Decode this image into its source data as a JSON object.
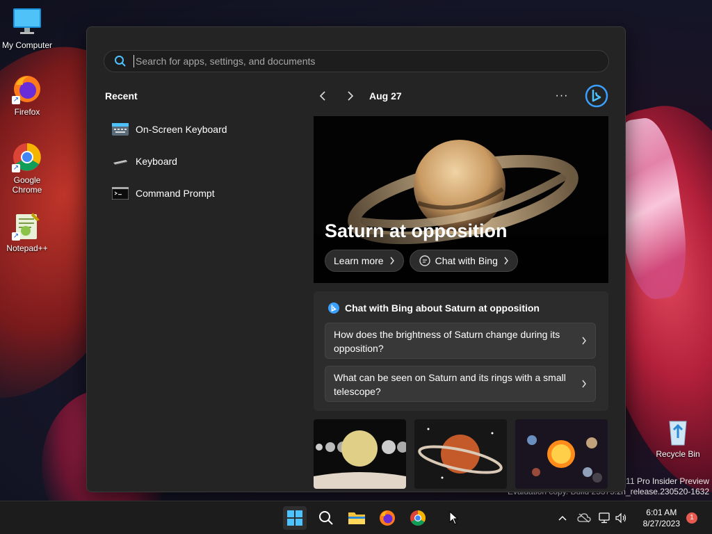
{
  "desktop": {
    "icons": [
      {
        "label": "My Computer"
      },
      {
        "label": "Firefox"
      },
      {
        "label": "Google Chrome"
      },
      {
        "label": "Notepad++"
      },
      {
        "label": "Recycle Bin"
      }
    ],
    "watermark": {
      "line1": "s 11 Pro Insider Preview",
      "line2": "Evaluation copy. Build 25375.zn_release.230520-1632"
    }
  },
  "start_menu": {
    "search": {
      "placeholder": "Search for apps, settings, and documents"
    },
    "recent": {
      "title": "Recent",
      "items": [
        {
          "label": "On-Screen Keyboard",
          "icon": "keyboard-app-icon"
        },
        {
          "label": "Keyboard",
          "icon": "keyboard-settings-icon"
        },
        {
          "label": "Command Prompt",
          "icon": "terminal-icon"
        }
      ]
    },
    "feed": {
      "date": "Aug 27",
      "more": "···",
      "hero": {
        "title": "Saturn at opposition",
        "learn_more": "Learn more",
        "chat_with_bing": "Chat with Bing"
      },
      "chat": {
        "heading": "Chat with Bing about Saturn at opposition",
        "questions": [
          "How does the brightness of Saturn change during its opposition?",
          "What can be seen on Saturn and its rings with a small telescope?"
        ]
      }
    }
  },
  "taskbar": {
    "clock": {
      "time": "6:01 AM",
      "date": "8/27/2023"
    },
    "notification_count": "1"
  },
  "colors": {
    "accent": "#0078d4",
    "panel": "#242424",
    "taskbar": "#1c1c1c"
  }
}
